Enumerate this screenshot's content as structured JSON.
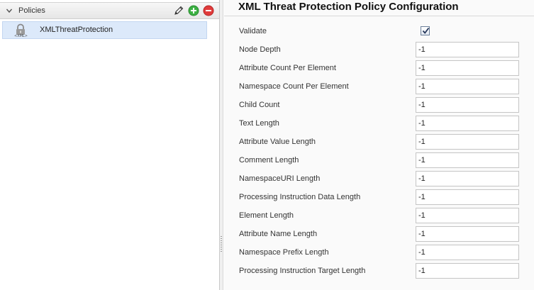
{
  "left_panel": {
    "title": "Policies",
    "icons": [
      "pencil-icon",
      "add-icon",
      "remove-icon"
    ],
    "items": [
      {
        "label": "XMLThreatProtection",
        "icon_tag": "<XML>",
        "selected": true
      }
    ]
  },
  "config": {
    "title": "XML Threat Protection Policy Configuration",
    "validate": {
      "label": "Validate",
      "checked": true
    },
    "fields": [
      {
        "label": "Node Depth",
        "value": "-1"
      },
      {
        "label": "Attribute Count Per Element",
        "value": "-1"
      },
      {
        "label": "Namespace Count Per Element",
        "value": "-1"
      },
      {
        "label": "Child Count",
        "value": "-1"
      },
      {
        "label": "Text Length",
        "value": "-1"
      },
      {
        "label": "Attribute Value Length",
        "value": "-1"
      },
      {
        "label": "Comment Length",
        "value": "-1"
      },
      {
        "label": "NamespaceURI Length",
        "value": "-1"
      },
      {
        "label": "Processing Instruction Data Length",
        "value": "-1"
      },
      {
        "label": "Element Length",
        "value": "-1"
      },
      {
        "label": "Attribute Name Length",
        "value": "-1"
      },
      {
        "label": "Namespace Prefix Length",
        "value": "-1"
      },
      {
        "label": "Processing Instruction Target Length",
        "value": "-1"
      }
    ]
  },
  "colors": {
    "selection": "#dce9fa",
    "add": "#3cb043",
    "remove": "#e03b3b"
  }
}
